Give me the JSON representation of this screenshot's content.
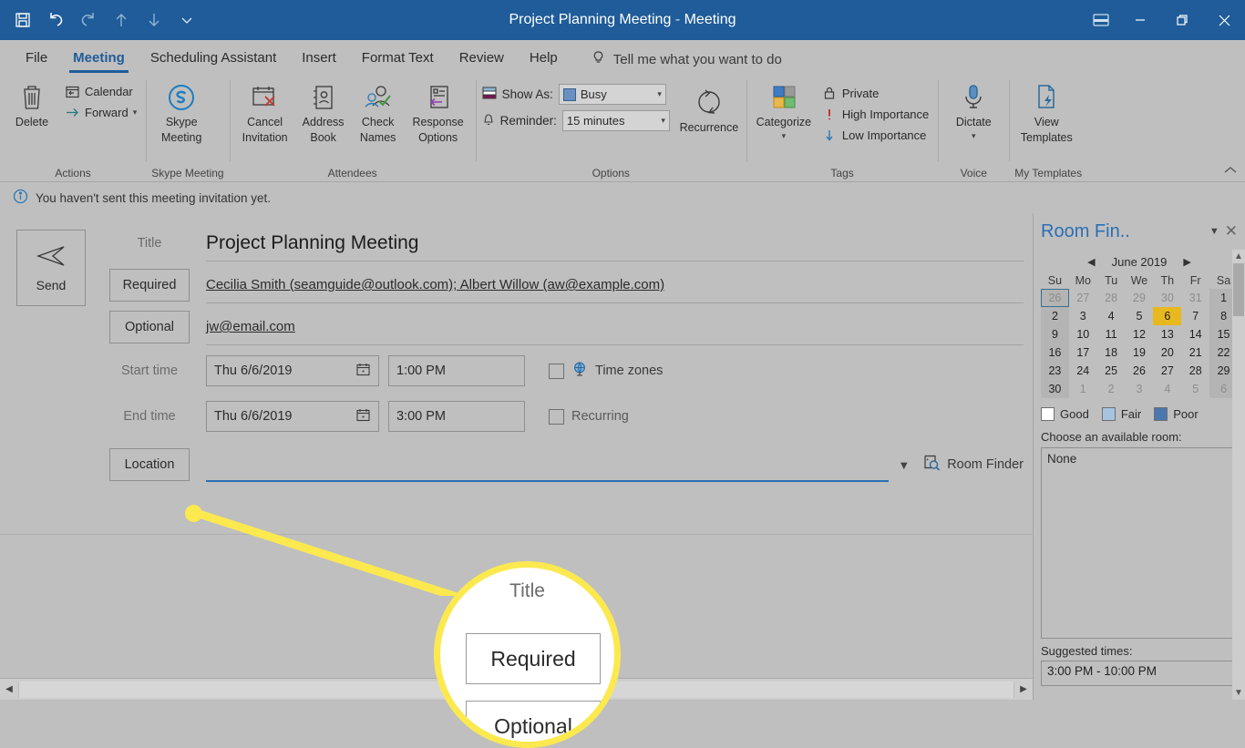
{
  "window": {
    "title": "Project Planning Meeting",
    "title_separator": "-",
    "title_suffix": "Meeting",
    "accent_color": "#1f5c99",
    "minimize_label": "Minimize",
    "restore_label": "Restore Down",
    "close_label": "Close",
    "ribbon_display_options_label": "Ribbon Display Options"
  },
  "quick_access": [
    {
      "name": "save",
      "label": "Save"
    },
    {
      "name": "undo",
      "label": "Undo"
    },
    {
      "name": "redo",
      "label": "Redo"
    },
    {
      "name": "previous-item",
      "label": "Previous Item"
    },
    {
      "name": "next-item",
      "label": "Next Item"
    },
    {
      "name": "customize",
      "label": "Customize Quick Access Toolbar"
    }
  ],
  "tabs": [
    {
      "label": "File",
      "active": false
    },
    {
      "label": "Meeting",
      "active": true
    },
    {
      "label": "Scheduling Assistant",
      "active": false
    },
    {
      "label": "Insert",
      "active": false
    },
    {
      "label": "Format Text",
      "active": false
    },
    {
      "label": "Review",
      "active": false
    },
    {
      "label": "Help",
      "active": false
    }
  ],
  "tell_me": {
    "label": "Tell me what you want to do"
  },
  "ribbon": {
    "groups": [
      {
        "label": "Actions",
        "delete_label": "Delete",
        "calendar_label": "Calendar",
        "forward_label": "Forward"
      },
      {
        "label": "Skype Meeting",
        "skype_line1": "Skype",
        "skype_line2": "Meeting"
      },
      {
        "label": "Attendees",
        "cancel_line1": "Cancel",
        "cancel_line2": "Invitation",
        "address_line1": "Address",
        "address_line2": "Book",
        "check_line1": "Check",
        "check_line2": "Names",
        "response_line1": "Response",
        "response_line2": "Options"
      },
      {
        "label": "Options",
        "show_as_label": "Show As:",
        "show_as_value": "Busy",
        "reminder_label": "Reminder:",
        "reminder_value": "15 minutes",
        "recurrence_label": "Recurrence"
      },
      {
        "label": "Tags",
        "categorize_label": "Categorize",
        "private_label": "Private",
        "high_importance_label": "High Importance",
        "low_importance_label": "Low Importance"
      },
      {
        "label": "Voice",
        "dictate_label": "Dictate"
      },
      {
        "label": "My Templates",
        "view_line1": "View",
        "view_line2": "Templates"
      }
    ],
    "collapse_label": "Collapse the Ribbon"
  },
  "info_bar": {
    "message": "You haven't sent this meeting invitation yet."
  },
  "form": {
    "send_label": "Send",
    "title_label": "Title",
    "title_value": "Project Planning Meeting",
    "required_label": "Required",
    "required_value": "Cecilia Smith (seamguide@outlook.com); Albert Willow (aw@example.com)",
    "optional_label": "Optional",
    "optional_value": "jw@email.com",
    "start_time_label": "Start time",
    "start_date_value": "Thu 6/6/2019",
    "start_time_value": "1:00 PM",
    "end_time_label": "End time",
    "end_date_value": "Thu 6/6/2019",
    "end_time_value": "3:00 PM",
    "time_zones_label": "Time zones",
    "time_zones_checked": false,
    "recurring_label": "Recurring",
    "recurring_checked": false,
    "location_label": "Location",
    "location_value": "",
    "room_finder_label": "Room Finder"
  },
  "room_finder": {
    "pane_title": "Room Fin..",
    "close_label": "Close",
    "month_label": "June 2019",
    "prev_label": "Previous month",
    "next_label": "Next month",
    "weekdays": [
      "Su",
      "Mo",
      "Tu",
      "We",
      "Th",
      "Fr",
      "Sa"
    ],
    "weeks": [
      [
        {
          "d": "26",
          "out": true,
          "wk": true,
          "today": true
        },
        {
          "d": "27",
          "out": true
        },
        {
          "d": "28",
          "out": true
        },
        {
          "d": "29",
          "out": true
        },
        {
          "d": "30",
          "out": true
        },
        {
          "d": "31",
          "out": true
        },
        {
          "d": "1",
          "wk": true
        }
      ],
      [
        {
          "d": "2",
          "wk": true
        },
        {
          "d": "3"
        },
        {
          "d": "4"
        },
        {
          "d": "5"
        },
        {
          "d": "6",
          "sel": true
        },
        {
          "d": "7"
        },
        {
          "d": "8",
          "wk": true
        }
      ],
      [
        {
          "d": "9",
          "wk": true
        },
        {
          "d": "10"
        },
        {
          "d": "11"
        },
        {
          "d": "12"
        },
        {
          "d": "13"
        },
        {
          "d": "14"
        },
        {
          "d": "15",
          "wk": true
        }
      ],
      [
        {
          "d": "16",
          "wk": true
        },
        {
          "d": "17"
        },
        {
          "d": "18"
        },
        {
          "d": "19"
        },
        {
          "d": "20"
        },
        {
          "d": "21"
        },
        {
          "d": "22",
          "wk": true
        }
      ],
      [
        {
          "d": "23",
          "wk": true
        },
        {
          "d": "24"
        },
        {
          "d": "25"
        },
        {
          "d": "26"
        },
        {
          "d": "27"
        },
        {
          "d": "28"
        },
        {
          "d": "29",
          "wk": true
        }
      ],
      [
        {
          "d": "30",
          "wk": true
        },
        {
          "d": "1",
          "out": true
        },
        {
          "d": "2",
          "out": true
        },
        {
          "d": "3",
          "out": true
        },
        {
          "d": "4",
          "out": true
        },
        {
          "d": "5",
          "out": true
        },
        {
          "d": "6",
          "out": true,
          "wk": true
        }
      ]
    ],
    "legend": [
      {
        "label": "Good",
        "color": "#ffffff"
      },
      {
        "label": "Fair",
        "color": "#a8c3e0"
      },
      {
        "label": "Poor",
        "color": "#4a77b0"
      }
    ],
    "choose_room_label": "Choose an available room:",
    "room_list": [
      "None"
    ],
    "suggested_times_label": "Suggested times:",
    "suggested_time_first": "3:00 PM - 10:00 PM"
  },
  "scrollbars": {
    "horizontal_left_label": "Scroll left",
    "horizontal_right_label": "Scroll right",
    "vertical_up_label": "Scroll up",
    "vertical_down_label": "Scroll down"
  }
}
